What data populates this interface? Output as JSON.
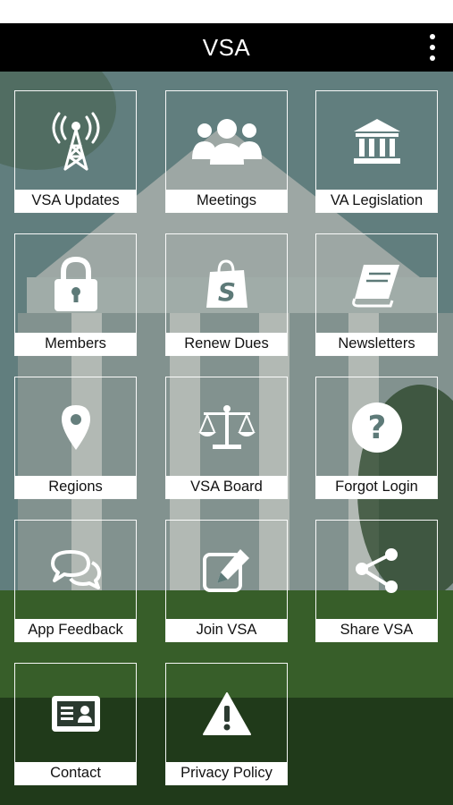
{
  "app_bar": {
    "title": "VSA",
    "menu_icon": "overflow-menu-icon"
  },
  "tiles": [
    {
      "label": "VSA Updates",
      "icon": "radio-tower-icon"
    },
    {
      "label": "Meetings",
      "icon": "group-icon"
    },
    {
      "label": "VA Legislation",
      "icon": "capitol-building-icon"
    },
    {
      "label": "Members",
      "icon": "lock-icon"
    },
    {
      "label": "Renew Dues",
      "icon": "shopping-bag-icon"
    },
    {
      "label": "Newsletters",
      "icon": "book-icon"
    },
    {
      "label": "Regions",
      "icon": "map-pin-icon"
    },
    {
      "label": "VSA Board",
      "icon": "scales-icon"
    },
    {
      "label": "Forgot Login",
      "icon": "question-icon"
    },
    {
      "label": "App Feedback",
      "icon": "chat-bubbles-icon"
    },
    {
      "label": "Join VSA",
      "icon": "edit-icon"
    },
    {
      "label": "Share VSA",
      "icon": "share-icon"
    },
    {
      "label": "Contact",
      "icon": "contact-card-icon"
    },
    {
      "label": "Privacy Policy",
      "icon": "warning-icon"
    }
  ]
}
